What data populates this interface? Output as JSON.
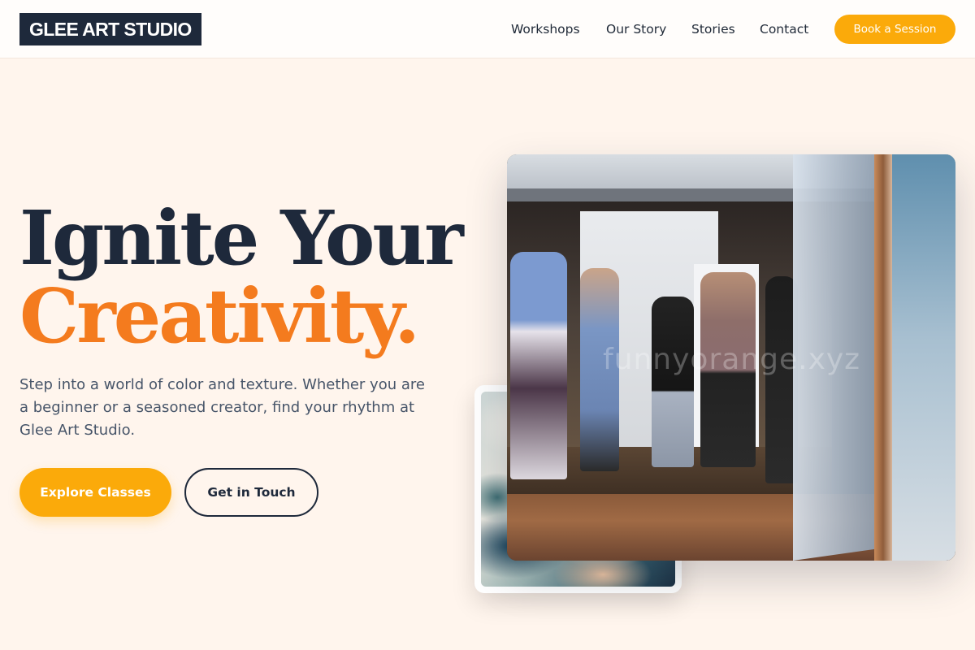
{
  "header": {
    "logo": "GLEE ART STUDIO",
    "nav": [
      "Workshops",
      "Our Story",
      "Stories",
      "Contact"
    ],
    "cta": "Book a Session"
  },
  "hero": {
    "headline_line1": "Ignite Your",
    "headline_line2": "Creativity.",
    "description": "Step into a world of color and texture. Whether you are a beginner or a seasoned creator, find your rhythm at Glee Art Studio.",
    "primary_button": "Explore Classes",
    "secondary_button": "Get in Touch"
  },
  "images": {
    "main_photo_watermark": "funnyorange.xyz"
  },
  "colors": {
    "background": "#fff5ed",
    "navy": "#1e293b",
    "accent_orange": "#f47b1e",
    "button_amber": "#fbaa0a"
  }
}
